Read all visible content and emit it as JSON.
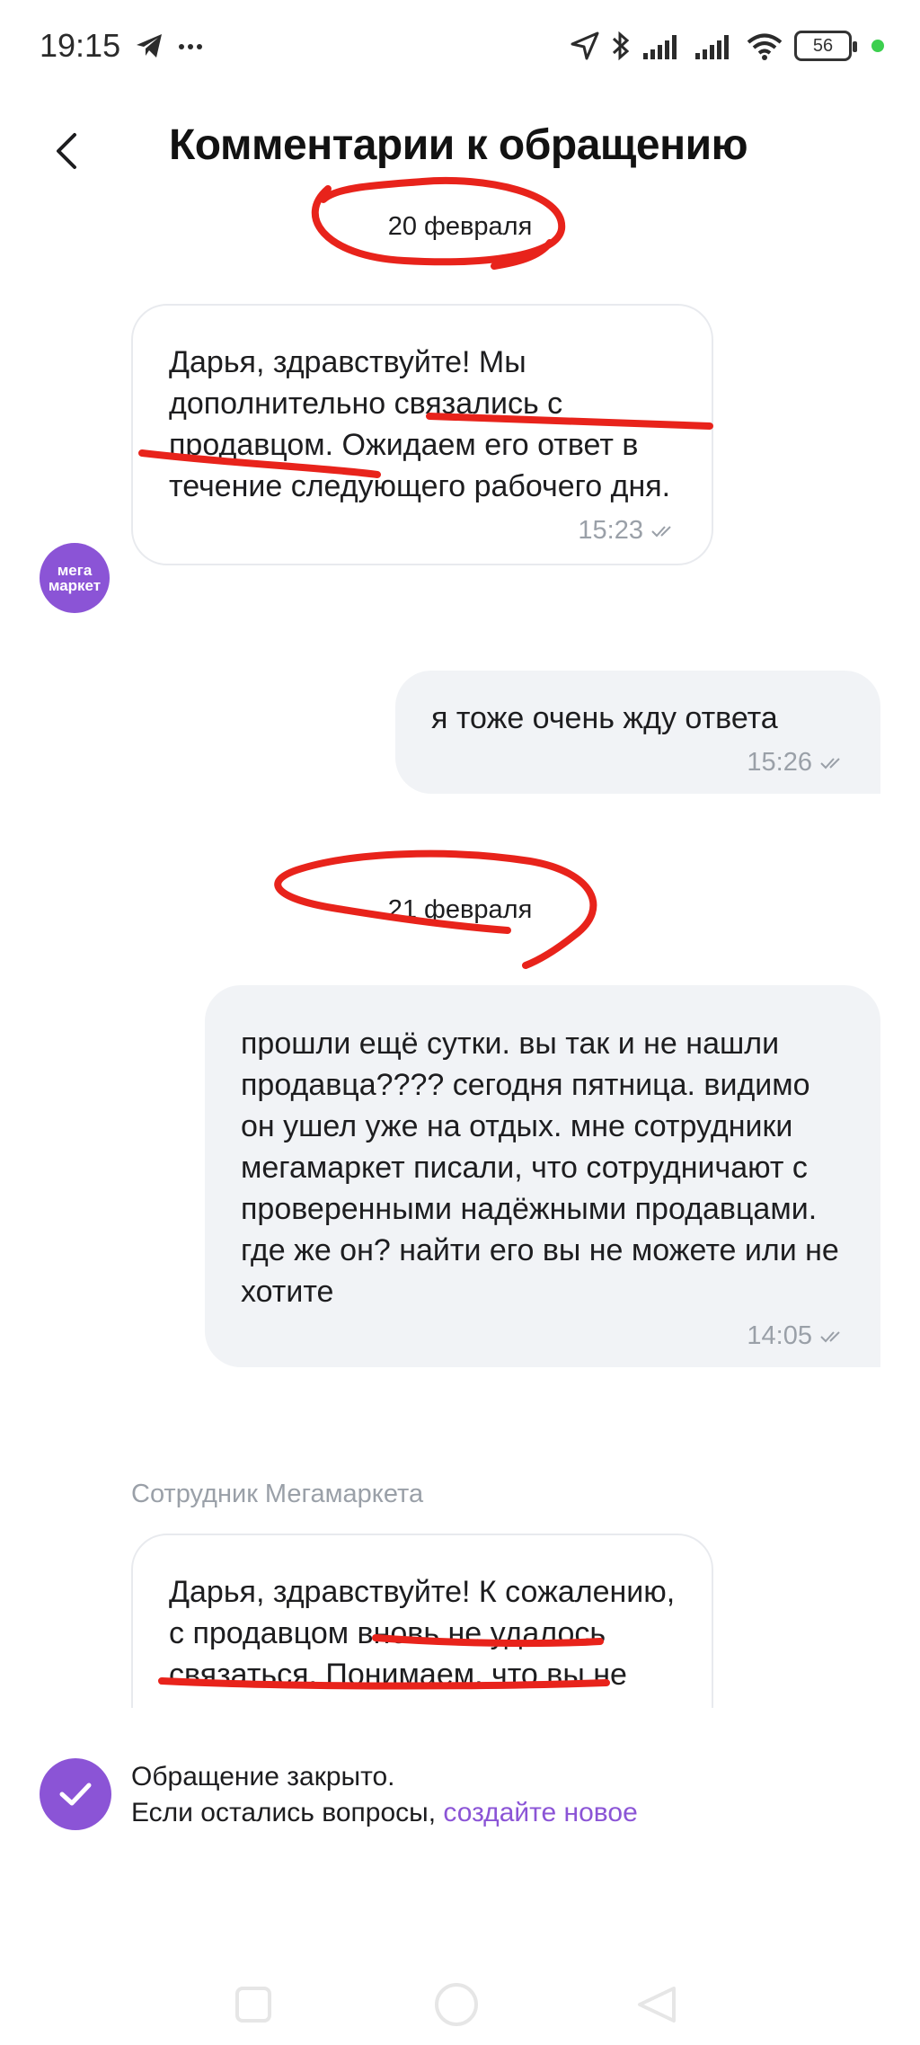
{
  "status": {
    "time": "19:15",
    "battery": "56",
    "icons": [
      "telegram-icon",
      "more-icon",
      "location-icon",
      "bluetooth-icon",
      "signal-icon",
      "signal-icon",
      "wifi-icon",
      "battery-icon"
    ]
  },
  "header": {
    "title": "Комментарии к обращению",
    "back_icon": "chevron-left-icon"
  },
  "messages": {
    "date1": "20 февраля",
    "m1": {
      "text": "Дарья, здравствуйте! Мы дополнительно связались с продавцом. Ожидаем его ответ в течение следующего рабочего дня.",
      "time": "15:23"
    },
    "avatar": {
      "line1": "мега",
      "line2": "маркет"
    },
    "m2": {
      "text": "я тоже очень жду ответа",
      "time": "15:26"
    },
    "date2": "21 февраля",
    "m3": {
      "text": "прошли ещё сутки. вы так и не нашли продавца???? сегодня пятница. видимо он ушел уже на отдых. мне сотрудники мегамаркет писали, что сотрудничают с проверенными надёжными продавцами. где же он? найти его вы не можете или не хотите",
      "time": "14:05"
    },
    "sender": "Сотрудник Мегамаркета",
    "m4": {
      "text": "Дарья, здравствуйте! К сожалению, с продавцом вновь не удалось связаться. Понимаем, что вы не ожидали"
    }
  },
  "closed": {
    "line1": "Обращение закрыто.",
    "line2_prefix": "Если остались вопросы, ",
    "link": "создайте новое"
  },
  "colors": {
    "accent": "#8b54d6",
    "annotation": "#e8231b",
    "bubble_out": "#f1f3f6",
    "meta": "#9aa0a8"
  }
}
